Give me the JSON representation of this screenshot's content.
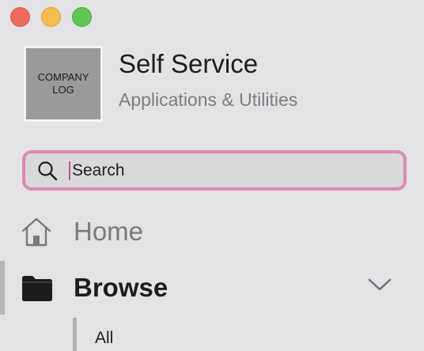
{
  "window": {
    "controls": [
      "close",
      "minimize",
      "maximize"
    ]
  },
  "header": {
    "logo_text": "COMPANY LOG",
    "title": "Self Service",
    "subtitle": "Applications & Utilities"
  },
  "search": {
    "placeholder": "Search",
    "value": "",
    "icon": "search-icon",
    "focus_ring_color": "#d98cb3"
  },
  "nav": {
    "items": [
      {
        "label": "Home",
        "icon": "home-icon",
        "selected": false
      },
      {
        "label": "Browse",
        "icon": "folder-icon",
        "selected": true,
        "expanded": true
      }
    ],
    "browse_subitems": [
      {
        "label": "All"
      }
    ]
  }
}
